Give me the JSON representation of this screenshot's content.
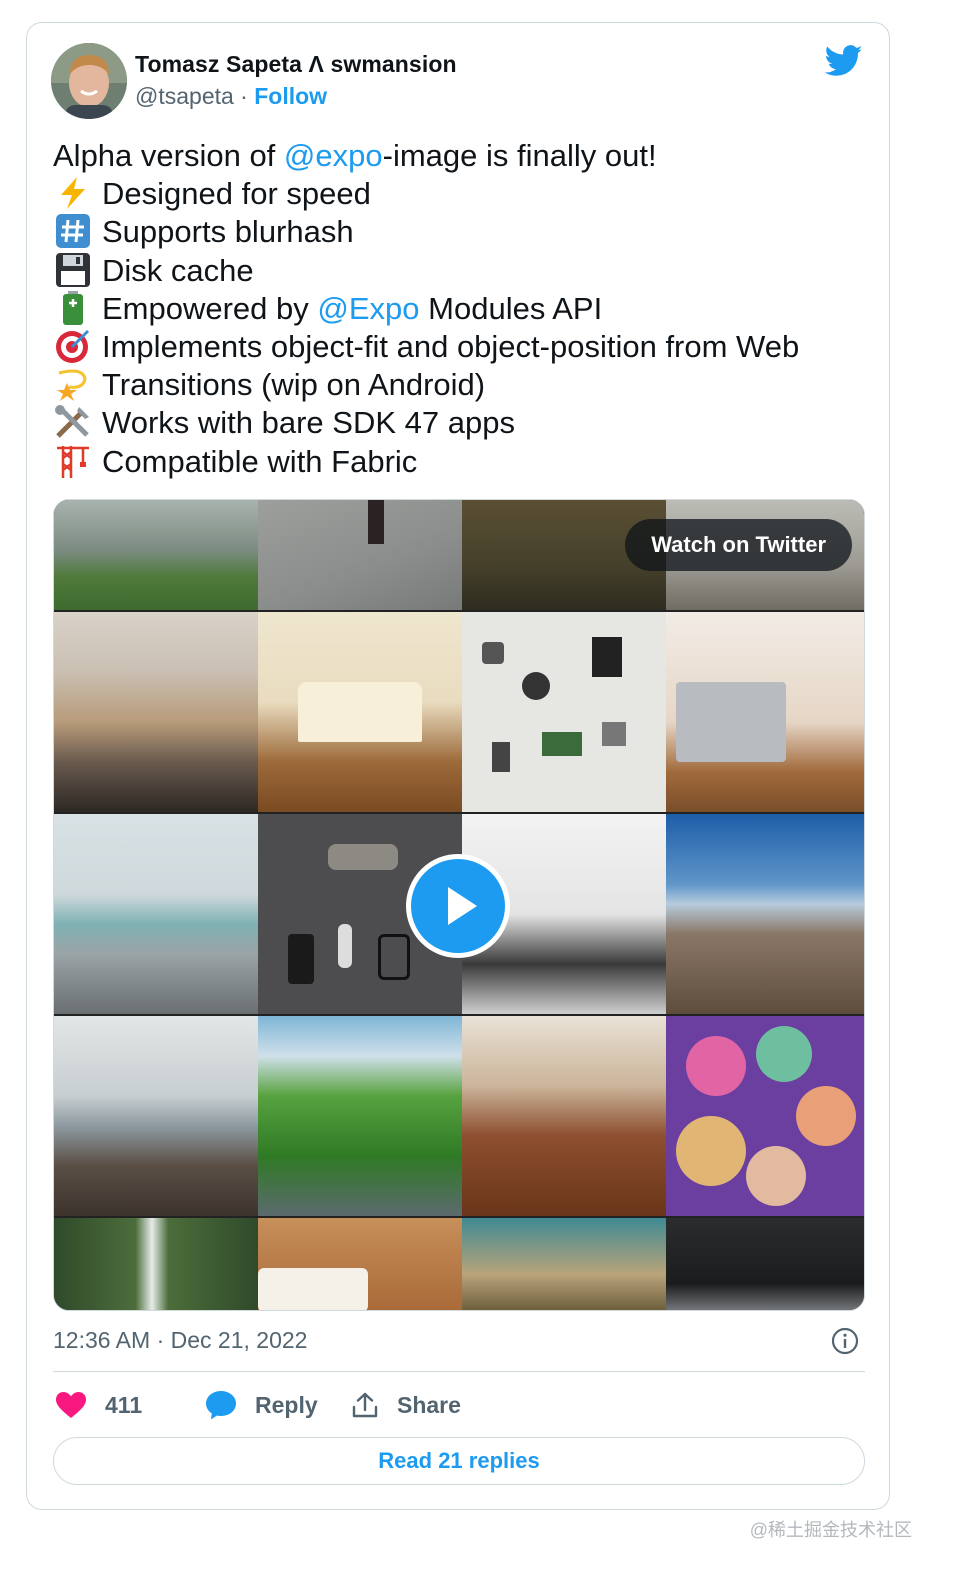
{
  "author": {
    "name": "Tomasz Sapeta Λ swmansion",
    "handle": "@tsapeta",
    "separator": " · ",
    "follow_label": "Follow"
  },
  "tweet": {
    "intro": {
      "before": "Alpha version of ",
      "mention": "@expo",
      "after": "-image is finally out!"
    },
    "items": [
      {
        "icon": "lightning-icon",
        "text": "Designed for speed"
      },
      {
        "icon": "hash-icon",
        "text": "Supports blurhash"
      },
      {
        "icon": "floppy-disk-icon",
        "text": "Disk cache"
      },
      {
        "icon": "battery-icon",
        "before": "Empowered by ",
        "mention": "@Expo",
        "after": " Modules API"
      },
      {
        "icon": "target-icon",
        "text": "Implements object-fit and object-position from Web"
      },
      {
        "icon": "dizzy-star-icon",
        "text": "Transitions (wip on Android)"
      },
      {
        "icon": "tools-icon",
        "text": "Works with bare SDK 47 apps"
      },
      {
        "icon": "crane-icon",
        "text": "Compatible with Fabric"
      }
    ]
  },
  "media": {
    "watch_label": "Watch on Twitter",
    "play_icon": "play-icon"
  },
  "timestamp": "12:36 AM · Dec 21, 2022",
  "actions": {
    "likes": "411",
    "reply_label": "Reply",
    "share_label": "Share"
  },
  "read_replies_label": "Read 21 replies",
  "watermark": "@稀土掘金技术社区",
  "colors": {
    "accent": "#1d9bf0",
    "like": "#f91880",
    "muted": "#536471",
    "border": "#cfd9de"
  }
}
